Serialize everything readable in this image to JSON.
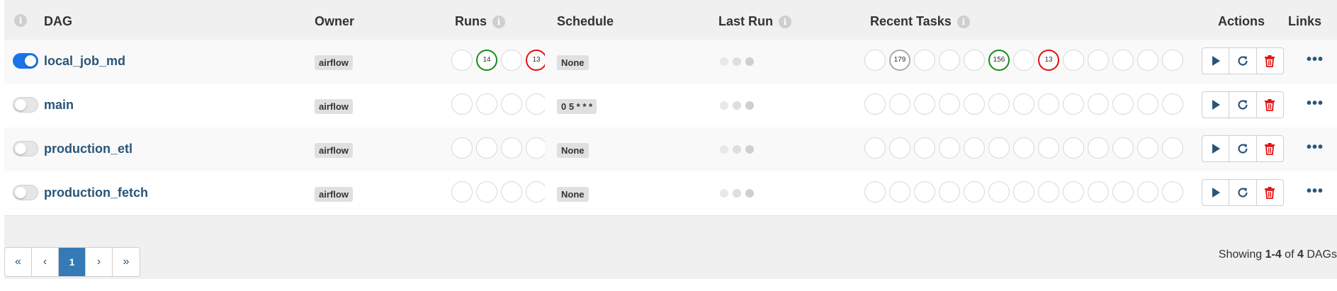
{
  "header": {
    "info_glyph": "i",
    "dag": "DAG",
    "owner": "Owner",
    "runs": "Runs",
    "schedule": "Schedule",
    "last_run": "Last Run",
    "recent_tasks": "Recent Tasks",
    "actions": "Actions",
    "links": "Links"
  },
  "rows": [
    {
      "enabled": true,
      "name": "local_job_md",
      "owner": "airflow",
      "runs": [
        {
          "label": "",
          "state": "none"
        },
        {
          "label": "14",
          "state": "success"
        },
        {
          "label": "",
          "state": "none"
        },
        {
          "label": "13",
          "state": "failed"
        }
      ],
      "schedule": "None",
      "recent_tasks": [
        {
          "label": "",
          "state": "none"
        },
        {
          "label": "179",
          "state": "grey"
        },
        {
          "label": "",
          "state": "none"
        },
        {
          "label": "",
          "state": "none"
        },
        {
          "label": "",
          "state": "none"
        },
        {
          "label": "156",
          "state": "success"
        },
        {
          "label": "",
          "state": "none"
        },
        {
          "label": "13",
          "state": "failed"
        },
        {
          "label": "",
          "state": "none"
        },
        {
          "label": "",
          "state": "none"
        },
        {
          "label": "",
          "state": "none"
        },
        {
          "label": "",
          "state": "none"
        },
        {
          "label": "",
          "state": "none"
        }
      ]
    },
    {
      "enabled": false,
      "name": "main",
      "owner": "airflow",
      "runs": [
        {
          "label": "",
          "state": "none"
        },
        {
          "label": "",
          "state": "none"
        },
        {
          "label": "",
          "state": "none"
        },
        {
          "label": "",
          "state": "none"
        }
      ],
      "schedule": "0 5 * * *",
      "recent_tasks": [
        {
          "label": "",
          "state": "none"
        },
        {
          "label": "",
          "state": "none"
        },
        {
          "label": "",
          "state": "none"
        },
        {
          "label": "",
          "state": "none"
        },
        {
          "label": "",
          "state": "none"
        },
        {
          "label": "",
          "state": "none"
        },
        {
          "label": "",
          "state": "none"
        },
        {
          "label": "",
          "state": "none"
        },
        {
          "label": "",
          "state": "none"
        },
        {
          "label": "",
          "state": "none"
        },
        {
          "label": "",
          "state": "none"
        },
        {
          "label": "",
          "state": "none"
        },
        {
          "label": "",
          "state": "none"
        }
      ]
    },
    {
      "enabled": false,
      "name": "production_etl",
      "owner": "airflow",
      "runs": [
        {
          "label": "",
          "state": "none"
        },
        {
          "label": "",
          "state": "none"
        },
        {
          "label": "",
          "state": "none"
        },
        {
          "label": "",
          "state": "none"
        }
      ],
      "schedule": "None",
      "recent_tasks": [
        {
          "label": "",
          "state": "none"
        },
        {
          "label": "",
          "state": "none"
        },
        {
          "label": "",
          "state": "none"
        },
        {
          "label": "",
          "state": "none"
        },
        {
          "label": "",
          "state": "none"
        },
        {
          "label": "",
          "state": "none"
        },
        {
          "label": "",
          "state": "none"
        },
        {
          "label": "",
          "state": "none"
        },
        {
          "label": "",
          "state": "none"
        },
        {
          "label": "",
          "state": "none"
        },
        {
          "label": "",
          "state": "none"
        },
        {
          "label": "",
          "state": "none"
        },
        {
          "label": "",
          "state": "none"
        }
      ]
    },
    {
      "enabled": false,
      "name": "production_fetch",
      "owner": "airflow",
      "runs": [
        {
          "label": "",
          "state": "none"
        },
        {
          "label": "",
          "state": "none"
        },
        {
          "label": "",
          "state": "none"
        },
        {
          "label": "",
          "state": "none"
        }
      ],
      "schedule": "None",
      "recent_tasks": [
        {
          "label": "",
          "state": "none"
        },
        {
          "label": "",
          "state": "none"
        },
        {
          "label": "",
          "state": "none"
        },
        {
          "label": "",
          "state": "none"
        },
        {
          "label": "",
          "state": "none"
        },
        {
          "label": "",
          "state": "none"
        },
        {
          "label": "",
          "state": "none"
        },
        {
          "label": "",
          "state": "none"
        },
        {
          "label": "",
          "state": "none"
        },
        {
          "label": "",
          "state": "none"
        },
        {
          "label": "",
          "state": "none"
        },
        {
          "label": "",
          "state": "none"
        },
        {
          "label": "",
          "state": "none"
        }
      ]
    }
  ],
  "actions_icons": [
    "play-icon",
    "refresh-icon",
    "trash-icon"
  ],
  "links_glyph": "•••",
  "pagination": {
    "first": "«",
    "prev": "‹",
    "current": "1",
    "next": "›",
    "last": "»"
  },
  "footer": {
    "showing_prefix": "Showing ",
    "range": "1-4",
    "of": " of ",
    "total": "4",
    "suffix": " DAGs"
  },
  "colors": {
    "toggle_on": "#1a73e8",
    "success": "#1a8a1a",
    "failed": "#e01010",
    "link": "#2a5578",
    "pager_active": "#337ab7",
    "delete": "#e01010"
  }
}
